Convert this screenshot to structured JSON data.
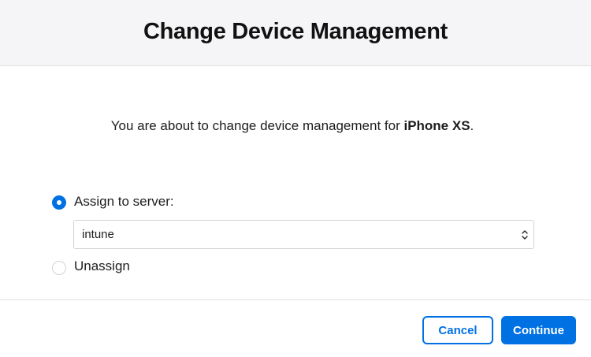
{
  "dialog": {
    "title": "Change Device Management",
    "message_prefix": "You are about to change device management for ",
    "device_name": "iPhone XS",
    "message_suffix": "."
  },
  "options": {
    "assign_label": "Assign to server:",
    "assign_selected": true,
    "server_select_value": "intune",
    "unassign_label": "Unassign",
    "unassign_selected": false
  },
  "footer": {
    "cancel_label": "Cancel",
    "continue_label": "Continue"
  },
  "colors": {
    "accent": "#0071e3",
    "header_bg": "#f5f5f7",
    "text": "#1d1d1f"
  },
  "icons": {
    "select_chevron": "chevron-up-down-icon"
  }
}
